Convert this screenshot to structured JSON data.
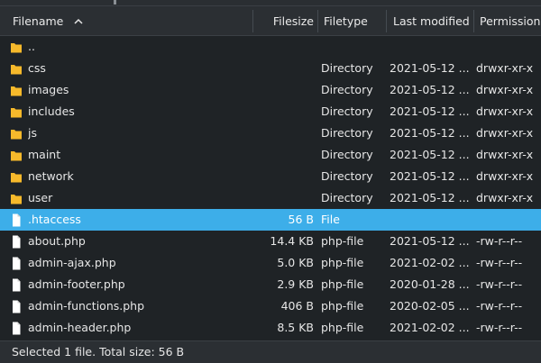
{
  "columns": {
    "filename": "Filename",
    "filesize": "Filesize",
    "filetype": "Filetype",
    "last_modified": "Last modified",
    "permissions": "Permissions"
  },
  "colors": {
    "folder": "#f6b92b",
    "selection": "#3daee9"
  },
  "files": [
    {
      "name": "..",
      "size": "",
      "type": "",
      "modified": "",
      "perms": "",
      "icon": "folder-icon"
    },
    {
      "name": "css",
      "size": "",
      "type": "Directory",
      "modified": "2021-05-12 ...",
      "perms": "drwxr-xr-x",
      "icon": "folder-icon"
    },
    {
      "name": "images",
      "size": "",
      "type": "Directory",
      "modified": "2021-05-12 ...",
      "perms": "drwxr-xr-x",
      "icon": "folder-icon"
    },
    {
      "name": "includes",
      "size": "",
      "type": "Directory",
      "modified": "2021-05-12 ...",
      "perms": "drwxr-xr-x",
      "icon": "folder-icon"
    },
    {
      "name": "js",
      "size": "",
      "type": "Directory",
      "modified": "2021-05-12 ...",
      "perms": "drwxr-xr-x",
      "icon": "folder-icon"
    },
    {
      "name": "maint",
      "size": "",
      "type": "Directory",
      "modified": "2021-05-12 ...",
      "perms": "drwxr-xr-x",
      "icon": "folder-icon"
    },
    {
      "name": "network",
      "size": "",
      "type": "Directory",
      "modified": "2021-05-12 ...",
      "perms": "drwxr-xr-x",
      "icon": "folder-icon"
    },
    {
      "name": "user",
      "size": "",
      "type": "Directory",
      "modified": "2021-05-12 ...",
      "perms": "drwxr-xr-x",
      "icon": "folder-icon"
    },
    {
      "name": ".htaccess",
      "size": "56 B",
      "type": "File",
      "modified": "",
      "perms": "",
      "icon": "file-icon",
      "selected": true
    },
    {
      "name": "about.php",
      "size": "14.4 KB",
      "type": "php-file",
      "modified": "2021-05-12 ...",
      "perms": "-rw-r--r--",
      "icon": "file-icon"
    },
    {
      "name": "admin-ajax.php",
      "size": "5.0 KB",
      "type": "php-file",
      "modified": "2021-02-02 ...",
      "perms": "-rw-r--r--",
      "icon": "file-icon"
    },
    {
      "name": "admin-footer.php",
      "size": "2.9 KB",
      "type": "php-file",
      "modified": "2020-01-28 ...",
      "perms": "-rw-r--r--",
      "icon": "file-icon"
    },
    {
      "name": "admin-functions.php",
      "size": "406 B",
      "type": "php-file",
      "modified": "2020-02-05 ...",
      "perms": "-rw-r--r--",
      "icon": "file-icon"
    },
    {
      "name": "admin-header.php",
      "size": "8.5 KB",
      "type": "php-file",
      "modified": "2021-02-02 ...",
      "perms": "-rw-r--r--",
      "icon": "file-icon"
    }
  ],
  "status": {
    "text": "Selected 1 file. Total size: 56 B"
  }
}
